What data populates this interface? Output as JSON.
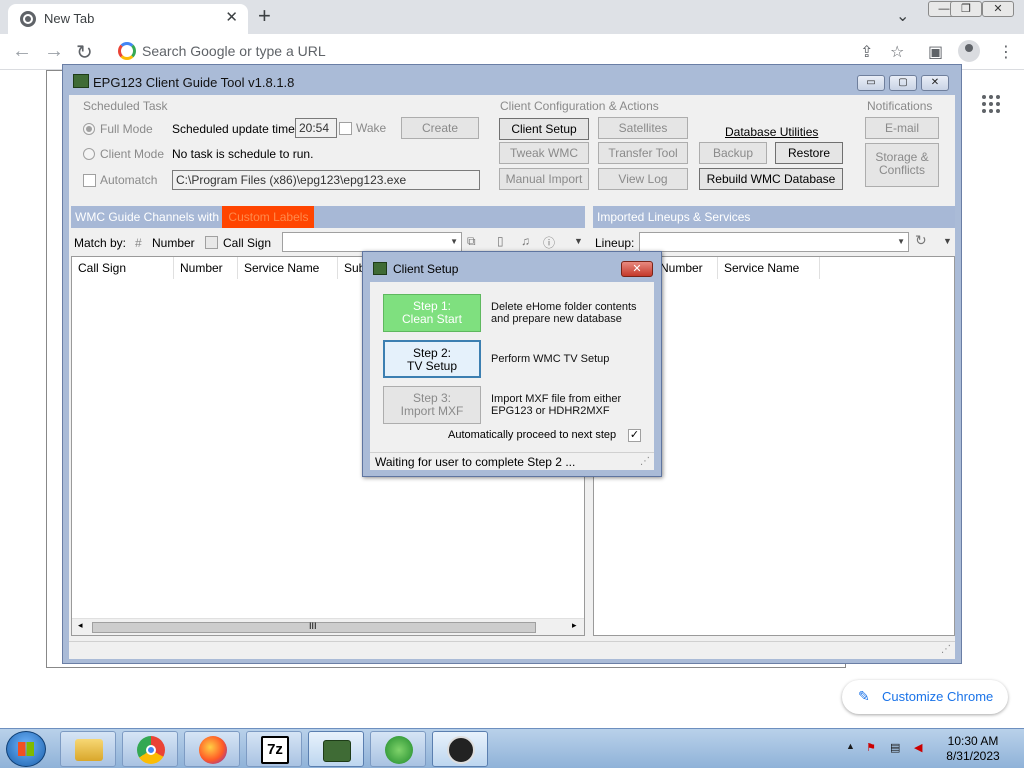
{
  "browser": {
    "tab_title": "New Tab",
    "omnibox_placeholder": "Search Google or type a URL",
    "customize_label": "Customize Chrome"
  },
  "epg": {
    "title": "EPG123 Client Guide Tool v1.8.1.8",
    "scheduled": {
      "group": "Scheduled Task",
      "full_mode": "Full Mode",
      "client_mode": "Client Mode",
      "automatch": "Automatch",
      "update_time_label": "Scheduled update time:",
      "update_time": "20:54",
      "wake": "Wake",
      "create": "Create",
      "task_status": "No task is schedule to run.",
      "path": "C:\\Program Files (x86)\\epg123\\epg123.exe"
    },
    "config": {
      "group": "Client Configuration & Actions",
      "client_setup": "Client Setup",
      "satellites": "Satellites",
      "tweak_wmc": "Tweak WMC",
      "transfer_tool": "Transfer Tool",
      "manual_import": "Manual Import",
      "view_log": "View Log",
      "db_utilities": "Database Utilities",
      "backup": "Backup",
      "restore": "Restore",
      "rebuild": "Rebuild WMC Database"
    },
    "notifications": {
      "group": "Notifications",
      "email": "E-mail",
      "storage_line1": "Storage &",
      "storage_line2": "Conflicts"
    },
    "wmc": {
      "header": "WMC Guide Channels with",
      "header_badge": "Custom Labels",
      "match_by": "Match by:",
      "number": "Number",
      "call_sign": "Call Sign",
      "columns": [
        "Call Sign",
        "Number",
        "Service Name",
        "Sub"
      ]
    },
    "imported": {
      "header": "Imported Lineups & Services",
      "lineup_label": "Lineup:",
      "columns": [
        "Number",
        "Service Name"
      ]
    },
    "scroll_grip": "III"
  },
  "dialog": {
    "title": "Client Setup",
    "step1_line1": "Step 1:",
    "step1_line2": "Clean Start",
    "step1_desc1": "Delete eHome folder contents",
    "step1_desc2": "and prepare new database",
    "step2_line1": "Step 2:",
    "step2_line2": "TV Setup",
    "step2_desc": "Perform WMC TV Setup",
    "step3_line1": "Step 3:",
    "step3_line2": "Import MXF",
    "step3_desc1": "Import MXF file from either",
    "step3_desc2": "EPG123 or HDHR2MXF",
    "auto_proceed": "Automatically proceed to next step",
    "status": "Waiting for user to complete Step 2 ..."
  },
  "taskbar": {
    "apps": [
      "explorer",
      "chrome",
      "firefox",
      "7-zip",
      "epg123",
      "windows-media-center",
      "epg123-client"
    ],
    "app_7z_label": "7z",
    "time": "10:30 AM",
    "date": "8/31/2023"
  },
  "colors": {
    "window_frame": "#aabbd7",
    "step1_green": "#7fe07f",
    "badge_orange": "#ff4500",
    "link_blue": "#1a73e8"
  }
}
